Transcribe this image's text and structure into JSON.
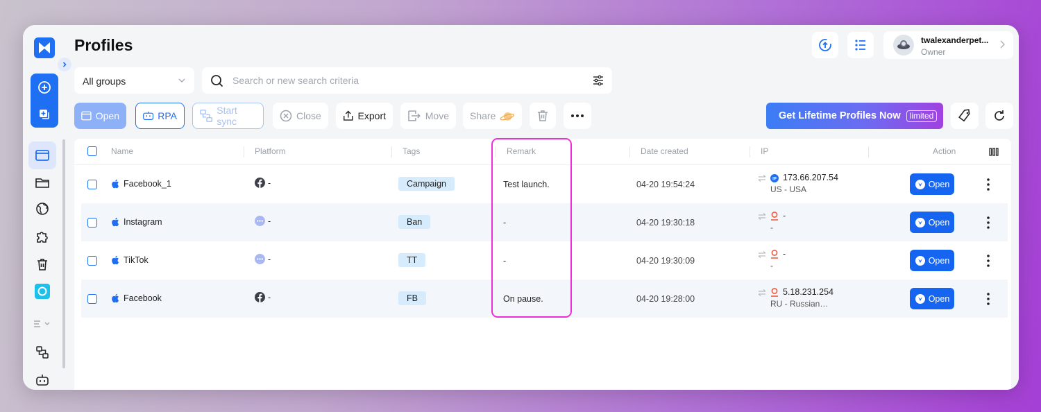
{
  "header": {
    "title": "Profiles",
    "user": {
      "name": "twalexanderpet...",
      "role": "Owner"
    }
  },
  "filters": {
    "group_select": "All groups",
    "search_placeholder": "Search or new search criteria"
  },
  "toolbar": {
    "open": "Open",
    "rpa": "RPA",
    "start_sync": "Start sync",
    "close": "Close",
    "export": "Export",
    "move": "Move",
    "share": "Share",
    "promo": "Get Lifetime Profiles Now",
    "promo_badge": "limited"
  },
  "table": {
    "columns": [
      "Name",
      "Platform",
      "Tags",
      "Remark",
      "Date created",
      "IP",
      "Action"
    ],
    "rows": [
      {
        "name": "Facebook_1",
        "platform": "-",
        "tag": "Campaign",
        "remark": "Test launch.",
        "date": "04-20 19:54:24",
        "ip": "173.66.207.54",
        "location": "US - USA",
        "action": "Open"
      },
      {
        "name": "Instagram",
        "platform": "-",
        "tag": "Ban",
        "remark": "-",
        "date": "04-20 19:30:18",
        "ip": "-",
        "location": "-",
        "action": "Open"
      },
      {
        "name": "TikTok",
        "platform": "-",
        "tag": "TT",
        "remark": "-",
        "date": "04-20 19:30:09",
        "ip": "-",
        "location": "-",
        "action": "Open"
      },
      {
        "name": "Facebook",
        "platform": "-",
        "tag": "FB",
        "remark": "On pause.",
        "date": "04-20 19:28:00",
        "ip": "5.18.231.254",
        "location": "RU - Russian…",
        "action": "Open"
      }
    ]
  },
  "colors": {
    "accent": "#1f6ff2",
    "highlight": "#ee2fd8",
    "tag_bg": "#d6ebfb"
  }
}
